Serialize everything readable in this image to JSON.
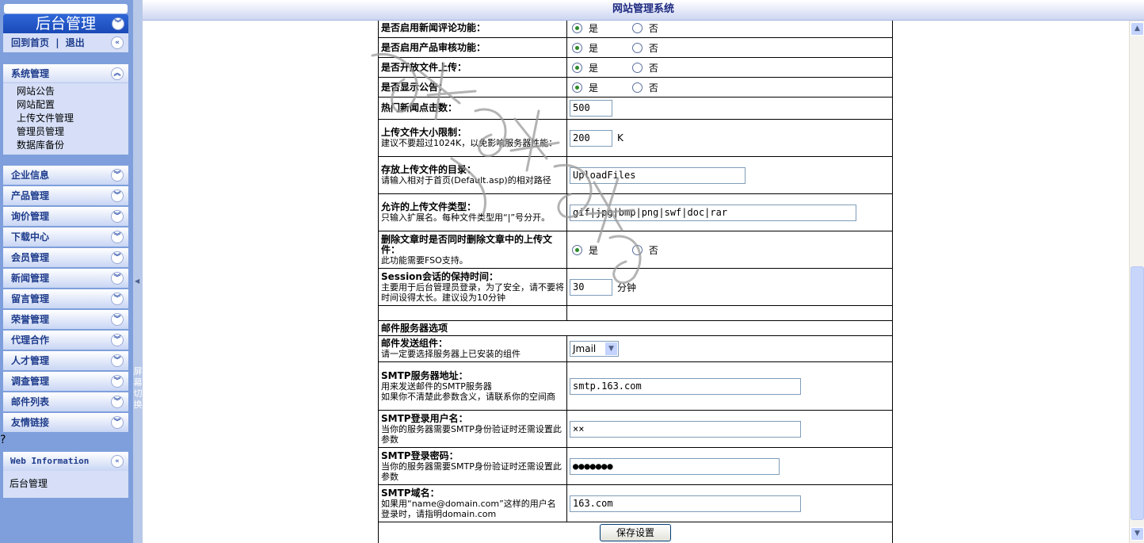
{
  "sidebar": {
    "title": "后台管理",
    "home_link": "回到首页",
    "separator": "|",
    "logout_link": "退出",
    "system_section": {
      "label": "系统管理",
      "items": [
        "网站公告",
        "网站配置",
        "上传文件管理",
        "管理员管理",
        "数据库备份"
      ]
    },
    "categories": [
      "企业信息",
      "产品管理",
      "询价管理",
      "下载中心",
      "会员管理",
      "新闻管理",
      "留言管理",
      "荣誉管理",
      "代理合作",
      "人才管理",
      "调查管理",
      "邮件列表",
      "友情链接"
    ],
    "question_mark": "?",
    "web_info": {
      "label": "Web Information",
      "content": "后台管理"
    }
  },
  "toggle_label": "屏幕切换",
  "header": {
    "title": "网站管理系统"
  },
  "form": {
    "yes_label": "是",
    "no_label": "否",
    "rows": {
      "news_comment": {
        "label": "是否启用新闻评论功能：",
        "value": "是"
      },
      "product_review": {
        "label": "是否启用产品审核功能：",
        "value": "是"
      },
      "file_upload": {
        "label": "是否开放文件上传：",
        "value": "是"
      },
      "show_notice": {
        "label": "是否显示公告：",
        "value": "是"
      },
      "hot_news": {
        "label": "热门新闻点击数：",
        "value": "500"
      },
      "upload_size": {
        "label": "上传文件大小限制：",
        "note": "建议不要超过1024K，以免影响服务器性能：",
        "value": "200",
        "unit": "K"
      },
      "upload_dir": {
        "label": "存放上传文件的目录：",
        "note": "请输入相对于首页(Default.asp)的相对路径",
        "value": "UploadFiles"
      },
      "upload_types": {
        "label": "允许的上传文件类型：",
        "note": "只输入扩展名。每种文件类型用“|”号分开。",
        "value": "gif|jpg|bmp|png|swf|doc|rar"
      },
      "delete_files": {
        "label": "删除文章时是否同时删除文章中的上传文件：",
        "note": "此功能需要FSO支持。",
        "value": "是"
      },
      "session_time": {
        "label": "Session会话的保持时间：",
        "note": "主要用于后台管理员登录，为了安全，请不要将时间设得太长。建议设为10分钟",
        "value": "30",
        "unit": "分钟"
      },
      "mail_section": "邮件服务器选项",
      "mail_component": {
        "label": "邮件发送组件：",
        "note": "请一定要选择服务器上已安装的组件",
        "value": "Jmail"
      },
      "smtp_server": {
        "label": "SMTP服务器地址：",
        "note": "用来发送邮件的SMTP服务器",
        "note2": "如果你不清楚此参数含义，请联系你的空间商",
        "value": "smtp.163.com"
      },
      "smtp_user": {
        "label": "SMTP登录用户名：",
        "note": "当你的服务器需要SMTP身份验证时还需设置此参数",
        "value": "××"
      },
      "smtp_pass": {
        "label": "SMTP登录密码：",
        "note": "当你的服务器需要SMTP身份验证时还需设置此参数",
        "value": "●●●●●●●"
      },
      "smtp_domain": {
        "label": "SMTP域名：",
        "note": "如果用“name@domain.com”这样的用户名登录时，请指明domain.com",
        "value": "163.com"
      }
    },
    "save_label": "保存设置"
  },
  "colors": {
    "sidebar_bg": "#7e9fdc",
    "header_text": "#1e2a80",
    "menu_text": "#1e3c8c"
  }
}
